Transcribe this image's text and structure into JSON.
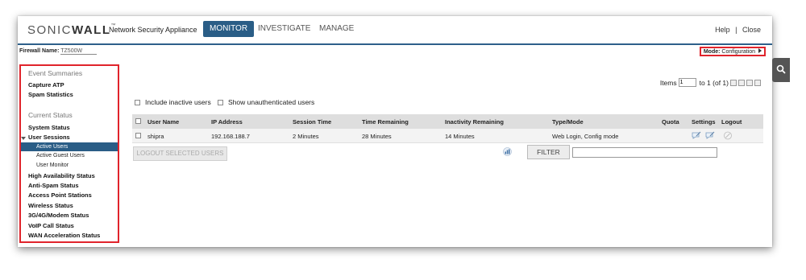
{
  "header": {
    "logo_text": "SONICWALL",
    "product_name": "Network Security Appliance",
    "tabs": [
      "MONITOR",
      "INVESTIGATE",
      "MANAGE"
    ],
    "help": "Help",
    "separator": "|",
    "close": "Close"
  },
  "firewall": {
    "label": "Firewall Name:",
    "name": "TZ500W"
  },
  "mode": {
    "label": "Mode:",
    "value": "Configuration"
  },
  "sidebar": {
    "event_section": "Event Summaries",
    "event_items": [
      "Capture ATP",
      "Spam Statistics"
    ],
    "status_section": "Current Status",
    "status_items": {
      "system_status": "System Status",
      "user_sessions": "User Sessions",
      "sub_items": [
        "Active Users",
        "Active Guest Users",
        "User Monitor"
      ],
      "rest": [
        "High Availability Status",
        "Anti-Spam Status",
        "Access Point Stations",
        "Wireless Status",
        "3G/4G/Modem Status",
        "VoIP Call Status",
        "WAN Acceleration Status"
      ]
    }
  },
  "pager": {
    "items_label": "Items",
    "start_value": "1",
    "range_text": "to 1 (of 1)"
  },
  "options": {
    "include_inactive": "Include inactive users",
    "show_unauth": "Show unauthenticated users"
  },
  "table": {
    "headers": [
      "User Name",
      "IP Address",
      "Session Time",
      "Time Remaining",
      "Inactivity Remaining",
      "Type/Mode",
      "Quota",
      "Settings",
      "Logout"
    ],
    "rows": [
      {
        "user": "shipra",
        "ip": "192.168.188.7",
        "session": "2 Minutes",
        "remaining": "28 Minutes",
        "inactivity": "14 Minutes",
        "type_mode": "Web Login, Config mode",
        "quota": ""
      }
    ]
  },
  "actions": {
    "logout_selected": "LOGOUT SELECTED USERS",
    "filter": "FILTER",
    "filter_value": ""
  },
  "colors": {
    "accent": "#2a5d86",
    "highlight_border": "#e0242c"
  },
  "icons": [
    "search-icon",
    "chart-icon",
    "settings-edit-icon",
    "logout-icon"
  ]
}
